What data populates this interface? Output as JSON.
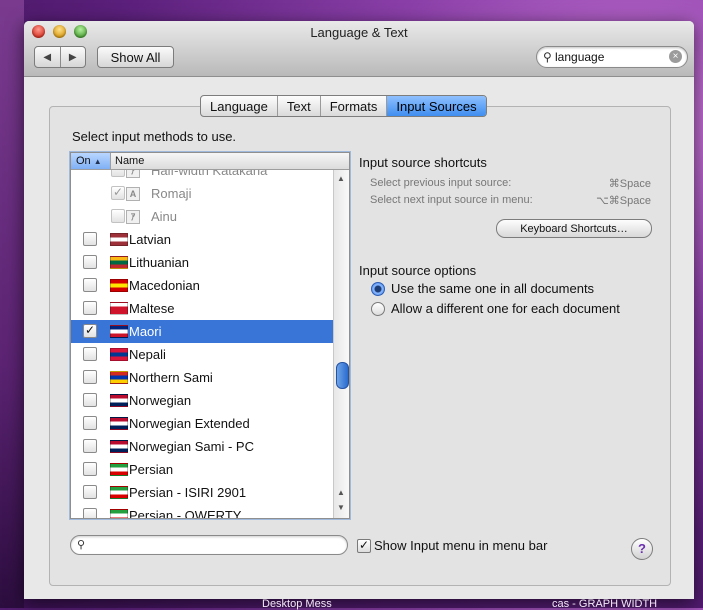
{
  "window": {
    "title": "Language & Text"
  },
  "toolbar": {
    "back": "◀",
    "forward": "▶",
    "show_all": "Show All"
  },
  "search": {
    "value": "language",
    "clear": "×"
  },
  "tabs": [
    {
      "label": "Language",
      "active": false
    },
    {
      "label": "Text",
      "active": false
    },
    {
      "label": "Formats",
      "active": false
    },
    {
      "label": "Input Sources",
      "active": true
    }
  ],
  "instructions": "Select input methods to use.",
  "list": {
    "col_on": "On",
    "col_name": "Name",
    "rows": [
      {
        "label": "Half-width Katakana",
        "checked": false,
        "sub": true,
        "glyph": "ｱ",
        "partial": true
      },
      {
        "label": "Romaji",
        "checked": true,
        "sub": true,
        "glyph": "A"
      },
      {
        "label": "Ainu",
        "checked": false,
        "sub": true,
        "glyph": "ｱ"
      },
      {
        "label": "Latvian",
        "checked": false,
        "flag": [
          "#9e3039",
          "#ffffff",
          "#9e3039"
        ]
      },
      {
        "label": "Lithuanian",
        "checked": false,
        "flag": [
          "#fdb913",
          "#006a44",
          "#c1272d"
        ]
      },
      {
        "label": "Macedonian",
        "checked": false,
        "flag": [
          "#d20000",
          "#ffe600",
          "#d20000"
        ]
      },
      {
        "label": "Maltese",
        "checked": false,
        "flag": [
          "#ffffff",
          "#cf142b",
          "#cf142b"
        ]
      },
      {
        "label": "Maori",
        "checked": true,
        "selected": true,
        "flag": [
          "#00247d",
          "#ffffff",
          "#cc142b"
        ]
      },
      {
        "label": "Nepali",
        "checked": false,
        "flag": [
          "#dc143c",
          "#003893",
          "#dc143c"
        ]
      },
      {
        "label": "Northern Sami",
        "checked": false,
        "flag": [
          "#d52b1e",
          "#0035ad",
          "#ffce00"
        ]
      },
      {
        "label": "Norwegian",
        "checked": false,
        "flag": [
          "#ba0c2f",
          "#ffffff",
          "#00205b"
        ]
      },
      {
        "label": "Norwegian Extended",
        "checked": false,
        "flag": [
          "#ba0c2f",
          "#ffffff",
          "#00205b"
        ]
      },
      {
        "label": "Norwegian Sami - PC",
        "checked": false,
        "flag": [
          "#ba0c2f",
          "#ffffff",
          "#00205b"
        ]
      },
      {
        "label": "Persian",
        "checked": false,
        "flag": [
          "#239f40",
          "#ffffff",
          "#da0000"
        ]
      },
      {
        "label": "Persian - ISIRI 2901",
        "checked": false,
        "flag": [
          "#239f40",
          "#ffffff",
          "#da0000"
        ]
      },
      {
        "label": "Persian - QWERTY",
        "checked": false,
        "flag": [
          "#239f40",
          "#ffffff",
          "#da0000"
        ]
      }
    ]
  },
  "shortcuts": {
    "title": "Input source shortcuts",
    "prev_label": "Select previous input source:",
    "prev_key": "⌘Space",
    "next_label": "Select next input source in menu:",
    "next_key": "⌥⌘Space",
    "button": "Keyboard Shortcuts…"
  },
  "options": {
    "title": "Input source options",
    "same": "Use the same one in all documents",
    "different": "Allow a different one for each document"
  },
  "footer": {
    "show_menu": "Show Input menu in menu bar",
    "show_menu_checked": true,
    "help": "?"
  },
  "desktop": {
    "left_text": "Desktop Mess",
    "right_text": "cas - GRAPH WIDTH"
  }
}
